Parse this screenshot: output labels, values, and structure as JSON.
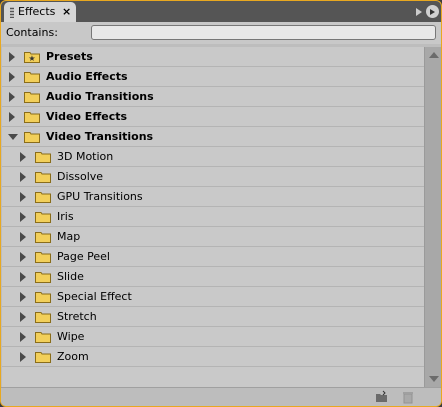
{
  "panel": {
    "tab_label": "Effects",
    "close_glyph": "×",
    "menu_icon": "panel-menu-icon"
  },
  "search": {
    "label": "Contains:",
    "value": "",
    "placeholder": ""
  },
  "tree": [
    {
      "label": "Presets",
      "level": 0,
      "expanded": false,
      "icon": "presets-folder-icon"
    },
    {
      "label": "Audio Effects",
      "level": 0,
      "expanded": false,
      "icon": "folder-icon"
    },
    {
      "label": "Audio Transitions",
      "level": 0,
      "expanded": false,
      "icon": "folder-icon"
    },
    {
      "label": "Video Effects",
      "level": 0,
      "expanded": false,
      "icon": "folder-icon"
    },
    {
      "label": "Video Transitions",
      "level": 0,
      "expanded": true,
      "icon": "folder-icon"
    },
    {
      "label": "3D Motion",
      "level": 1,
      "expanded": false,
      "icon": "folder-icon"
    },
    {
      "label": "Dissolve",
      "level": 1,
      "expanded": false,
      "icon": "folder-icon"
    },
    {
      "label": "GPU Transitions",
      "level": 1,
      "expanded": false,
      "icon": "folder-icon"
    },
    {
      "label": "Iris",
      "level": 1,
      "expanded": false,
      "icon": "folder-icon"
    },
    {
      "label": "Map",
      "level": 1,
      "expanded": false,
      "icon": "folder-icon"
    },
    {
      "label": "Page Peel",
      "level": 1,
      "expanded": false,
      "icon": "folder-icon"
    },
    {
      "label": "Slide",
      "level": 1,
      "expanded": false,
      "icon": "folder-icon"
    },
    {
      "label": "Special Effect",
      "level": 1,
      "expanded": false,
      "icon": "folder-icon"
    },
    {
      "label": "Stretch",
      "level": 1,
      "expanded": false,
      "icon": "folder-icon"
    },
    {
      "label": "Wipe",
      "level": 1,
      "expanded": false,
      "icon": "folder-icon"
    },
    {
      "label": "Zoom",
      "level": 1,
      "expanded": false,
      "icon": "folder-icon"
    }
  ],
  "footer": {
    "new_bin_icon": "new-custom-bin-icon",
    "delete_icon": "delete-icon"
  },
  "colors": {
    "accent": "#e8a820",
    "folder": "#f2cf5a",
    "panel_bg": "#c9c9c9"
  }
}
